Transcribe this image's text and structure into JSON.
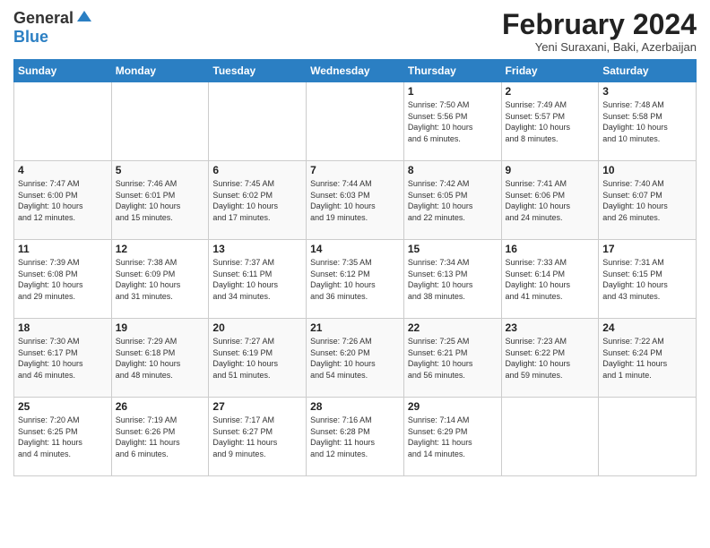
{
  "logo": {
    "line1": "General",
    "line2": "Blue"
  },
  "title": "February 2024",
  "subtitle": "Yeni Suraxani, Baki, Azerbaijan",
  "headers": [
    "Sunday",
    "Monday",
    "Tuesday",
    "Wednesday",
    "Thursday",
    "Friday",
    "Saturday"
  ],
  "weeks": [
    [
      {
        "day": "",
        "info": ""
      },
      {
        "day": "",
        "info": ""
      },
      {
        "day": "",
        "info": ""
      },
      {
        "day": "",
        "info": ""
      },
      {
        "day": "1",
        "info": "Sunrise: 7:50 AM\nSunset: 5:56 PM\nDaylight: 10 hours\nand 6 minutes."
      },
      {
        "day": "2",
        "info": "Sunrise: 7:49 AM\nSunset: 5:57 PM\nDaylight: 10 hours\nand 8 minutes."
      },
      {
        "day": "3",
        "info": "Sunrise: 7:48 AM\nSunset: 5:58 PM\nDaylight: 10 hours\nand 10 minutes."
      }
    ],
    [
      {
        "day": "4",
        "info": "Sunrise: 7:47 AM\nSunset: 6:00 PM\nDaylight: 10 hours\nand 12 minutes."
      },
      {
        "day": "5",
        "info": "Sunrise: 7:46 AM\nSunset: 6:01 PM\nDaylight: 10 hours\nand 15 minutes."
      },
      {
        "day": "6",
        "info": "Sunrise: 7:45 AM\nSunset: 6:02 PM\nDaylight: 10 hours\nand 17 minutes."
      },
      {
        "day": "7",
        "info": "Sunrise: 7:44 AM\nSunset: 6:03 PM\nDaylight: 10 hours\nand 19 minutes."
      },
      {
        "day": "8",
        "info": "Sunrise: 7:42 AM\nSunset: 6:05 PM\nDaylight: 10 hours\nand 22 minutes."
      },
      {
        "day": "9",
        "info": "Sunrise: 7:41 AM\nSunset: 6:06 PM\nDaylight: 10 hours\nand 24 minutes."
      },
      {
        "day": "10",
        "info": "Sunrise: 7:40 AM\nSunset: 6:07 PM\nDaylight: 10 hours\nand 26 minutes."
      }
    ],
    [
      {
        "day": "11",
        "info": "Sunrise: 7:39 AM\nSunset: 6:08 PM\nDaylight: 10 hours\nand 29 minutes."
      },
      {
        "day": "12",
        "info": "Sunrise: 7:38 AM\nSunset: 6:09 PM\nDaylight: 10 hours\nand 31 minutes."
      },
      {
        "day": "13",
        "info": "Sunrise: 7:37 AM\nSunset: 6:11 PM\nDaylight: 10 hours\nand 34 minutes."
      },
      {
        "day": "14",
        "info": "Sunrise: 7:35 AM\nSunset: 6:12 PM\nDaylight: 10 hours\nand 36 minutes."
      },
      {
        "day": "15",
        "info": "Sunrise: 7:34 AM\nSunset: 6:13 PM\nDaylight: 10 hours\nand 38 minutes."
      },
      {
        "day": "16",
        "info": "Sunrise: 7:33 AM\nSunset: 6:14 PM\nDaylight: 10 hours\nand 41 minutes."
      },
      {
        "day": "17",
        "info": "Sunrise: 7:31 AM\nSunset: 6:15 PM\nDaylight: 10 hours\nand 43 minutes."
      }
    ],
    [
      {
        "day": "18",
        "info": "Sunrise: 7:30 AM\nSunset: 6:17 PM\nDaylight: 10 hours\nand 46 minutes."
      },
      {
        "day": "19",
        "info": "Sunrise: 7:29 AM\nSunset: 6:18 PM\nDaylight: 10 hours\nand 48 minutes."
      },
      {
        "day": "20",
        "info": "Sunrise: 7:27 AM\nSunset: 6:19 PM\nDaylight: 10 hours\nand 51 minutes."
      },
      {
        "day": "21",
        "info": "Sunrise: 7:26 AM\nSunset: 6:20 PM\nDaylight: 10 hours\nand 54 minutes."
      },
      {
        "day": "22",
        "info": "Sunrise: 7:25 AM\nSunset: 6:21 PM\nDaylight: 10 hours\nand 56 minutes."
      },
      {
        "day": "23",
        "info": "Sunrise: 7:23 AM\nSunset: 6:22 PM\nDaylight: 10 hours\nand 59 minutes."
      },
      {
        "day": "24",
        "info": "Sunrise: 7:22 AM\nSunset: 6:24 PM\nDaylight: 11 hours\nand 1 minute."
      }
    ],
    [
      {
        "day": "25",
        "info": "Sunrise: 7:20 AM\nSunset: 6:25 PM\nDaylight: 11 hours\nand 4 minutes."
      },
      {
        "day": "26",
        "info": "Sunrise: 7:19 AM\nSunset: 6:26 PM\nDaylight: 11 hours\nand 6 minutes."
      },
      {
        "day": "27",
        "info": "Sunrise: 7:17 AM\nSunset: 6:27 PM\nDaylight: 11 hours\nand 9 minutes."
      },
      {
        "day": "28",
        "info": "Sunrise: 7:16 AM\nSunset: 6:28 PM\nDaylight: 11 hours\nand 12 minutes."
      },
      {
        "day": "29",
        "info": "Sunrise: 7:14 AM\nSunset: 6:29 PM\nDaylight: 11 hours\nand 14 minutes."
      },
      {
        "day": "",
        "info": ""
      },
      {
        "day": "",
        "info": ""
      }
    ]
  ]
}
